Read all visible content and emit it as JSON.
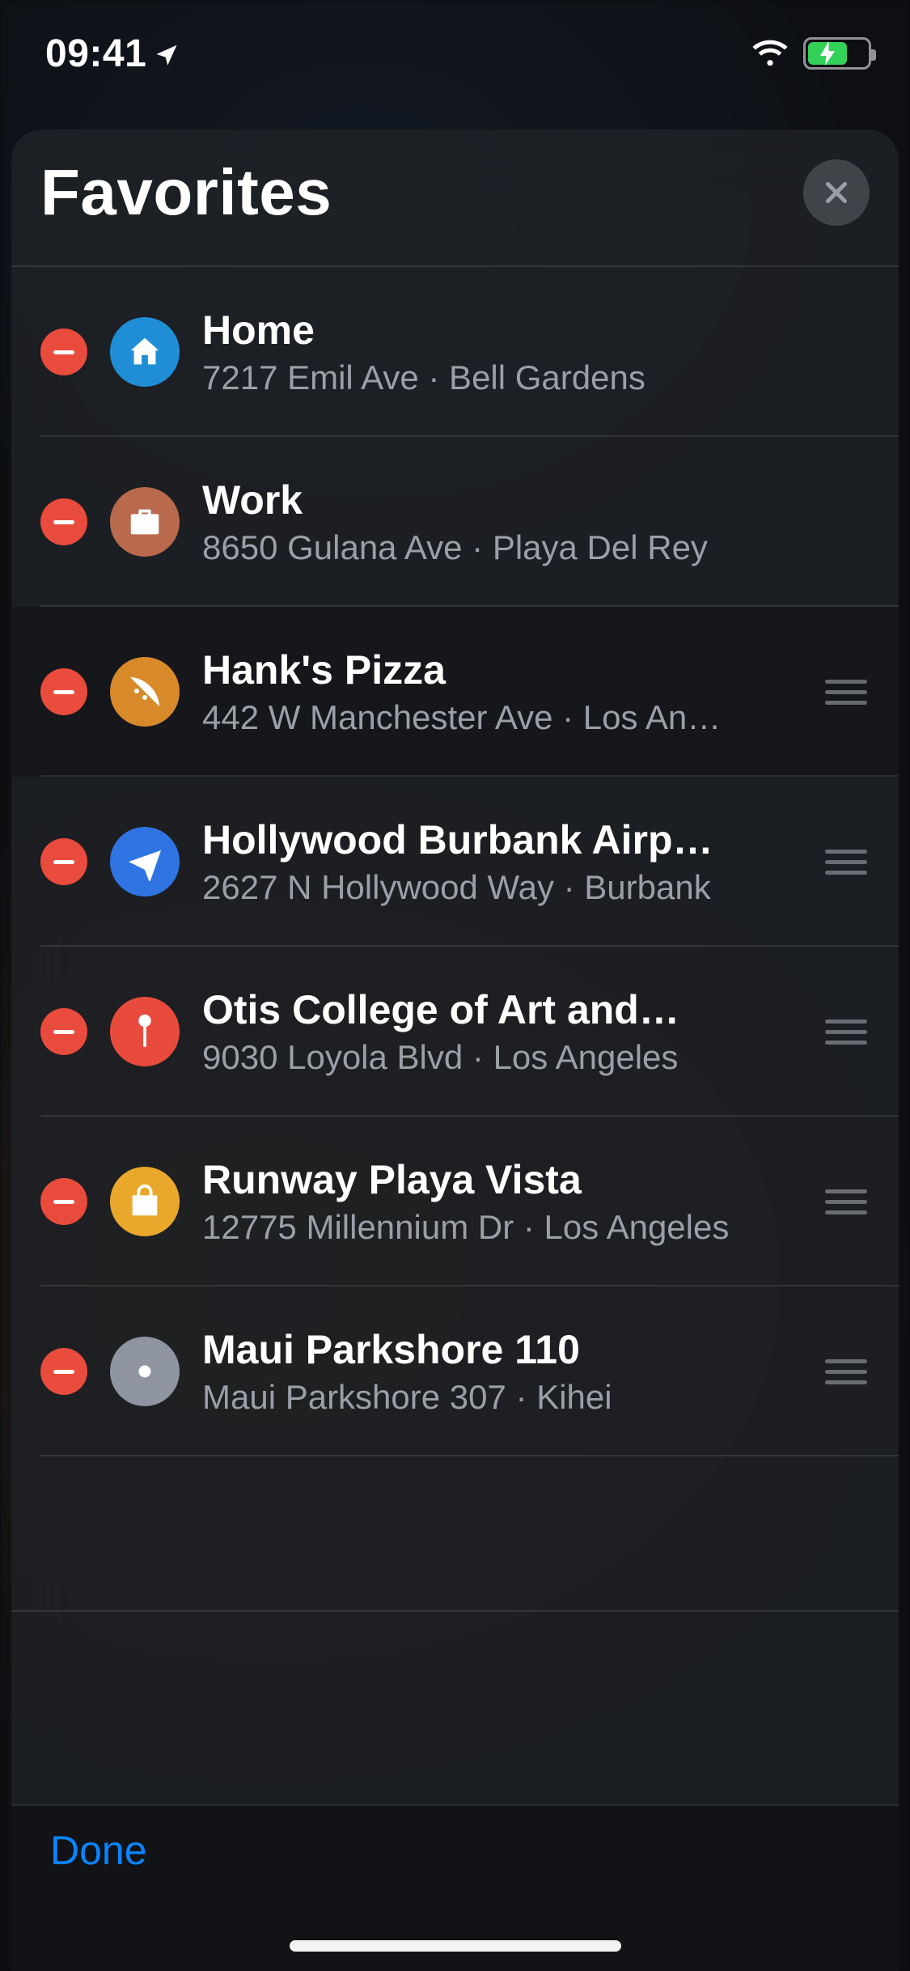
{
  "status_bar": {
    "time": "09:41",
    "location_arrow": true,
    "wifi": true,
    "battery_charging": true
  },
  "sheet": {
    "title": "Favorites"
  },
  "favorites": [
    {
      "icon": "home-icon",
      "icon_class": "ic-home",
      "name": "Home",
      "subtitle": "7217 Emil Ave · Bell Gardens",
      "draggable": false,
      "highlight": false
    },
    {
      "icon": "briefcase-icon",
      "icon_class": "ic-work",
      "name": "Work",
      "subtitle": "8650 Gulana Ave · Playa Del Rey",
      "draggable": false,
      "highlight": false
    },
    {
      "icon": "pizza-icon",
      "icon_class": "ic-pizza",
      "name": "Hank's Pizza",
      "subtitle": "442 W Manchester Ave · Los An…",
      "draggable": true,
      "highlight": true
    },
    {
      "icon": "airplane-icon",
      "icon_class": "ic-plane",
      "name": "Hollywood Burbank Airp…",
      "subtitle": "2627 N Hollywood Way · Burbank",
      "draggable": true,
      "highlight": false
    },
    {
      "icon": "pin-icon",
      "icon_class": "ic-pin",
      "name": "Otis College of Art and…",
      "subtitle": "9030 Loyola Blvd · Los Angeles",
      "draggable": true,
      "highlight": false
    },
    {
      "icon": "shopping-icon",
      "icon_class": "ic-shop",
      "name": "Runway Playa Vista",
      "subtitle": "12775 Millennium Dr · Los Angeles",
      "draggable": true,
      "highlight": false
    },
    {
      "icon": "dot-icon",
      "icon_class": "ic-dot",
      "name": "Maui Parkshore 110",
      "subtitle": "Maui Parkshore 307 · Kihei",
      "draggable": true,
      "highlight": false
    }
  ],
  "footer": {
    "done_label": "Done"
  }
}
